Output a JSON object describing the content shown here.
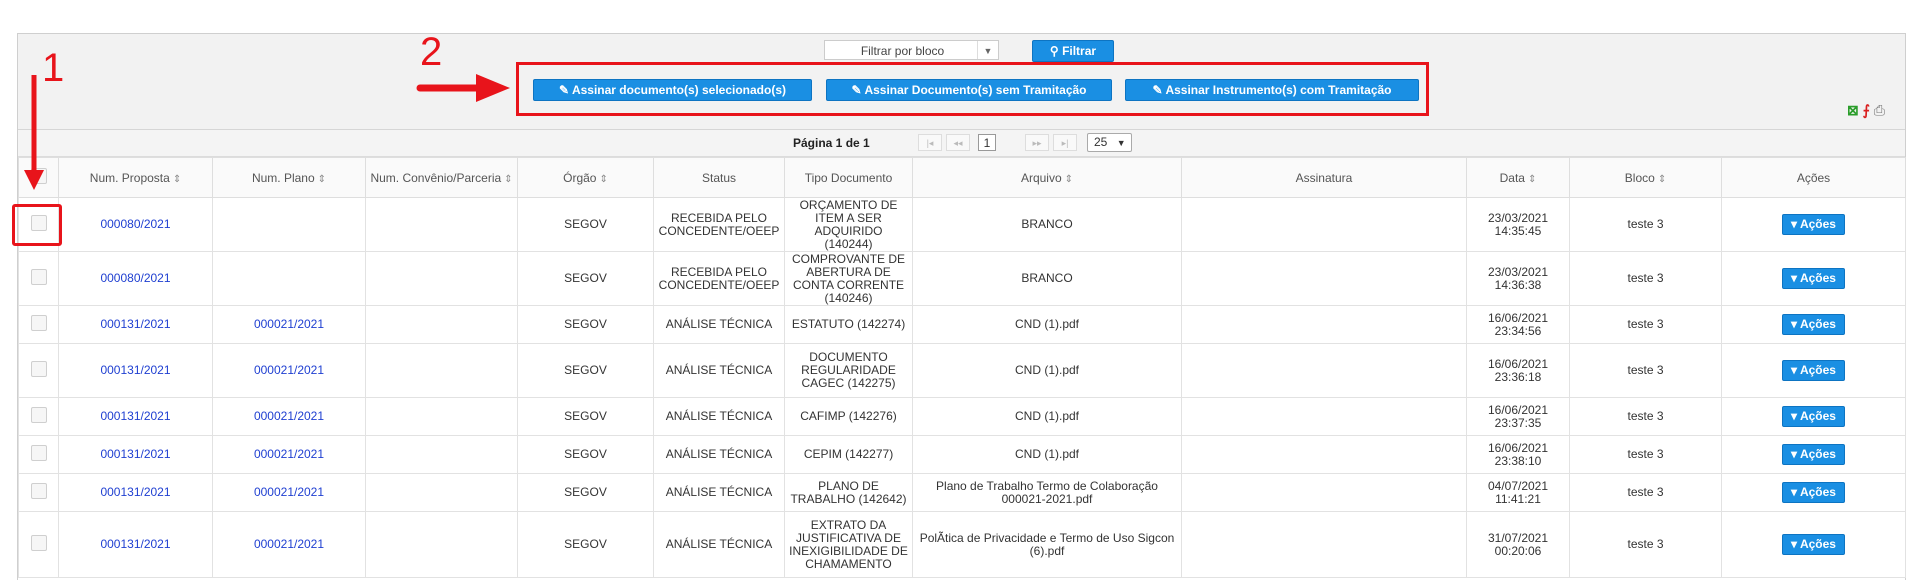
{
  "toolbar": {
    "filter_select_value": "Filtrar por bloco",
    "filter_button": "Filtrar",
    "sign_selected": "Assinar documento(s) selecionado(s)",
    "sign_no_process": "Assinar Documento(s) sem Tramitação",
    "sign_instrument": "Assinar Instrumento(s) com Tramitação"
  },
  "annotations": {
    "one": "1",
    "two": "2"
  },
  "pager": {
    "label": "Página 1 de 1",
    "current": "1",
    "page_size": "25"
  },
  "table": {
    "headers": {
      "proposta": "Num. Proposta",
      "plano": "Num. Plano",
      "convenio": "Num. Convênio/Parceria",
      "orgao": "Órgão",
      "status": "Status",
      "tipo": "Tipo Documento",
      "arquivo": "Arquivo",
      "assinatura": "Assinatura",
      "data": "Data",
      "bloco": "Bloco",
      "acoes": "Ações"
    },
    "action_label": "Ações",
    "rows": [
      {
        "proposta": "000080/2021",
        "plano": "",
        "convenio": "",
        "orgao": "SEGOV",
        "status": "RECEBIDA PELO CONCEDENTE/OEEP",
        "tipo": "ORÇAMENTO DE ITEM A SER ADQUIRIDO (140244)",
        "arquivo": "BRANCO",
        "assinatura": "",
        "data": "23/03/2021 14:35:45",
        "bloco": "teste 3"
      },
      {
        "proposta": "000080/2021",
        "plano": "",
        "convenio": "",
        "orgao": "SEGOV",
        "status": "RECEBIDA PELO CONCEDENTE/OEEP",
        "tipo": "COMPROVANTE DE ABERTURA DE CONTA CORRENTE (140246)",
        "arquivo": "BRANCO",
        "assinatura": "",
        "data": "23/03/2021 14:36:38",
        "bloco": "teste 3"
      },
      {
        "proposta": "000131/2021",
        "plano": "000021/2021",
        "convenio": "",
        "orgao": "SEGOV",
        "status": "ANÁLISE TÉCNICA",
        "tipo": "ESTATUTO (142274)",
        "arquivo": "CND (1).pdf",
        "assinatura": "",
        "data": "16/06/2021 23:34:56",
        "bloco": "teste 3"
      },
      {
        "proposta": "000131/2021",
        "plano": "000021/2021",
        "convenio": "",
        "orgao": "SEGOV",
        "status": "ANÁLISE TÉCNICA",
        "tipo": "DOCUMENTO REGULARIDADE CAGEC (142275)",
        "arquivo": "CND (1).pdf",
        "assinatura": "",
        "data": "16/06/2021 23:36:18",
        "bloco": "teste 3"
      },
      {
        "proposta": "000131/2021",
        "plano": "000021/2021",
        "convenio": "",
        "orgao": "SEGOV",
        "status": "ANÁLISE TÉCNICA",
        "tipo": "CAFIMP (142276)",
        "arquivo": "CND (1).pdf",
        "assinatura": "",
        "data": "16/06/2021 23:37:35",
        "bloco": "teste 3"
      },
      {
        "proposta": "000131/2021",
        "plano": "000021/2021",
        "convenio": "",
        "orgao": "SEGOV",
        "status": "ANÁLISE TÉCNICA",
        "tipo": "CEPIM (142277)",
        "arquivo": "CND (1).pdf",
        "assinatura": "",
        "data": "16/06/2021 23:38:10",
        "bloco": "teste 3"
      },
      {
        "proposta": "000131/2021",
        "plano": "000021/2021",
        "convenio": "",
        "orgao": "SEGOV",
        "status": "ANÁLISE TÉCNICA",
        "tipo": "PLANO DE TRABALHO (142642)",
        "arquivo": "Plano de Trabalho Termo de Colaboração 000021-2021.pdf",
        "assinatura": "",
        "data": "04/07/2021 11:41:21",
        "bloco": "teste 3"
      },
      {
        "proposta": "000131/2021",
        "plano": "000021/2021",
        "convenio": "",
        "orgao": "SEGOV",
        "status": "ANÁLISE TÉCNICA",
        "tipo": "EXTRATO DA JUSTIFICATIVA DE INEXIGIBILIDADE DE CHAMAMENTO",
        "arquivo": "PolÃtica de Privacidade e Termo de Uso Sigcon (6).pdf",
        "assinatura": "",
        "data": "31/07/2021 00:20:06",
        "bloco": "teste 3"
      }
    ]
  }
}
